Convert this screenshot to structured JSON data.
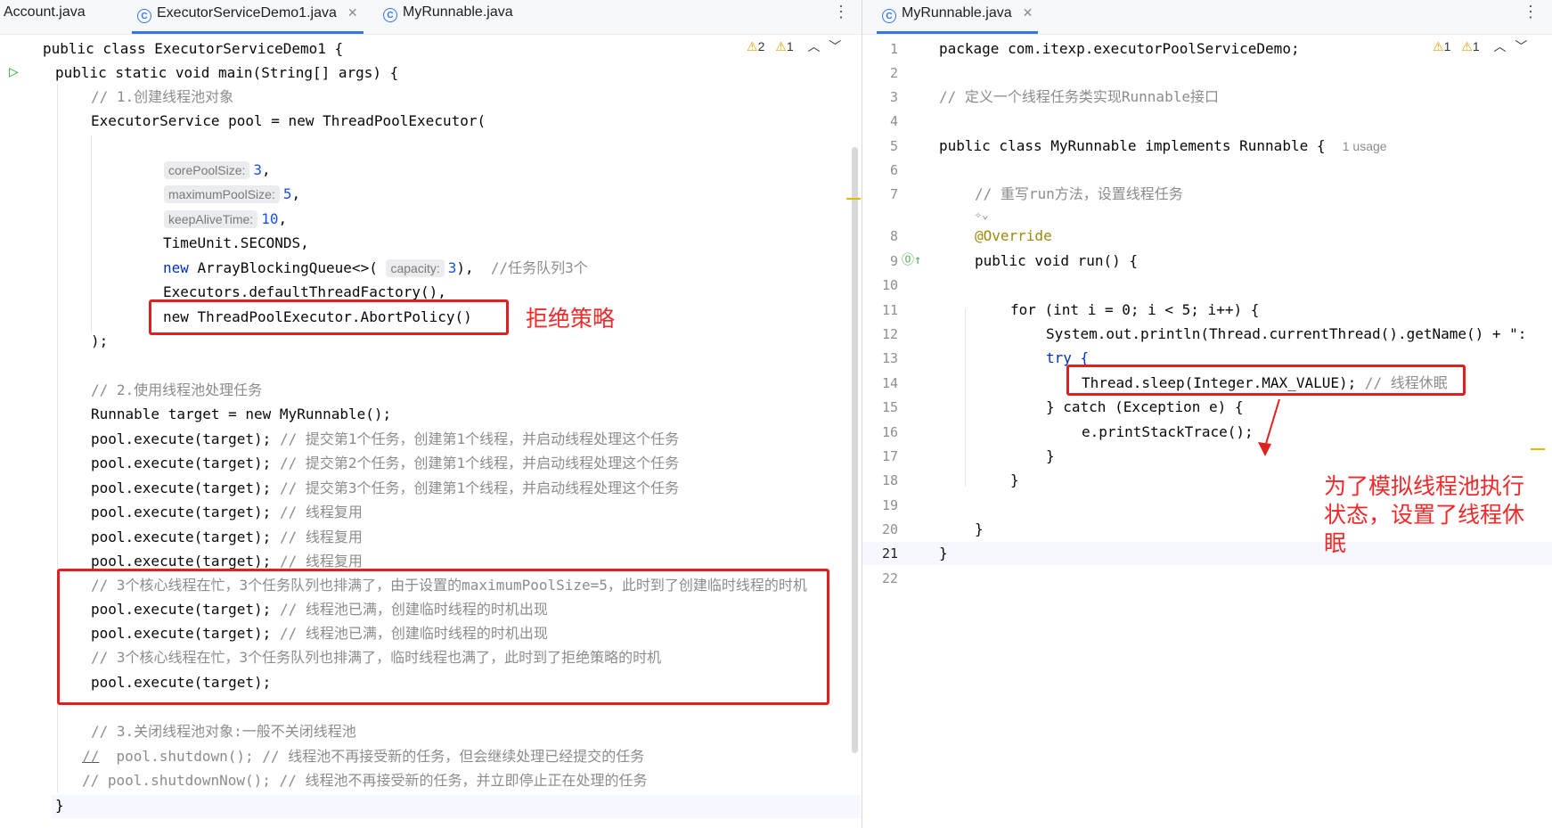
{
  "left_editor": {
    "tabs": [
      {
        "label": "Account.java",
        "active": false
      },
      {
        "label": "ExecutorServiceDemo1.java",
        "active": true
      },
      {
        "label": "MyRunnable.java",
        "active": false
      }
    ],
    "inspection": {
      "warnings": "2",
      "weak_warnings": "1"
    },
    "lines": {
      "l0": "public class ExecutorServiceDemo1 {",
      "l1": "public static void main(String[] args) {",
      "l2": "// 1.创建线程池对象",
      "l3": "ExecutorService pool = new ThreadPoolExecutor(",
      "l5_hint": "corePoolSize:",
      "l5_val": "3",
      "l6_hint": "maximumPoolSize:",
      "l6_val": "5",
      "l7_hint": "keepAliveTime:",
      "l7_val": "10",
      "l8": "TimeUnit.SECONDS,",
      "l9_hint": "capacity:",
      "l9_val": "3",
      "l9_comment": "//任务队列3个",
      "l10": "Executors.defaultThreadFactory(),",
      "l11": "new ThreadPoolExecutor.AbortPolicy()",
      "l12": ");",
      "l14": "// 2.使用线程池处理任务",
      "l15": "Runnable target = new MyRunnable();",
      "l16_comment": "// 提交第1个任务，创建第1个线程，并启动线程处理这个任务",
      "l17_comment": "// 提交第2个任务，创建第1个线程，并启动线程处理这个任务",
      "l18_comment": "// 提交第3个任务，创建第1个线程，并启动线程处理这个任务",
      "reuse_comment": "// 线程复用",
      "l22": "// 3个核心线程在忙，3个任务队列也排满了，由于设置的maximumPoolSize=5，此时到了创建临时线程的时机",
      "temp_comment": "// 线程池已满，创建临时线程的时机出现",
      "l25": "// 3个核心线程在忙，3个任务队列也排满了，临时线程也满了，此时到了拒绝策略的时机",
      "execute": "pool.execute(target);",
      "l28": "// 3.关闭线程池对象:一般不关闭线程池",
      "l29_a": "//",
      "l29_b": "  pool.shutdown(); // 线程池不再接受新的任务，但会继续处理已经提交的任务",
      "l30": "// pool.shutdownNow(); // 线程池不再接受新的任务，并立即停止正在处理的任务",
      "l31": "}"
    },
    "annotation_label": "拒绝策略"
  },
  "right_editor": {
    "tabs": [
      {
        "label": "MyRunnable.java",
        "active": true
      }
    ],
    "inspection": {
      "warnings": "1",
      "weak_warnings": "1"
    },
    "line_numbers": [
      "1",
      "2",
      "3",
      "4",
      "5",
      "6",
      "7",
      "8",
      "9",
      "10",
      "11",
      "12",
      "13",
      "14",
      "15",
      "16",
      "17",
      "18",
      "19",
      "20",
      "21",
      "22"
    ],
    "lines": {
      "l1": "package com.itexp.executorPoolServiceDemo;",
      "l3": "// 定义一个线程任务类实现Runnable接口",
      "l5": "public class MyRunnable implements Runnable {",
      "l5_usage": "1 usage",
      "l7": "// 重写run方法，设置线程任务",
      "l8": "@Override",
      "l9": "public void run() {",
      "l11": "for (int i = 0; i < 5; i++) {",
      "l12": "System.out.println(Thread.currentThread().getName() + \":",
      "l13": "try {",
      "l14_code": "Thread.sleep(Integer.MAX_VALUE);",
      "l14_comment": "// 线程休眠",
      "l15": "} catch (Exception e) {",
      "l16": "e.printStackTrace();",
      "l17": "}",
      "l18": "}",
      "l20": "}",
      "l21": "}"
    },
    "annotation_label": "为了模拟线程池执行状态，设置了线程休眠"
  },
  "colors": {
    "keyword": "#0033b3",
    "comment": "#8c8c8c",
    "number": "#1750eb",
    "annotation_red": "#e02020",
    "tab_accent": "#3574f0"
  },
  "icons": [
    "run-icon",
    "java-class-icon",
    "close-icon",
    "more-icon",
    "warning-icon",
    "chevron-up-icon",
    "chevron-down-icon",
    "override-icon"
  ]
}
